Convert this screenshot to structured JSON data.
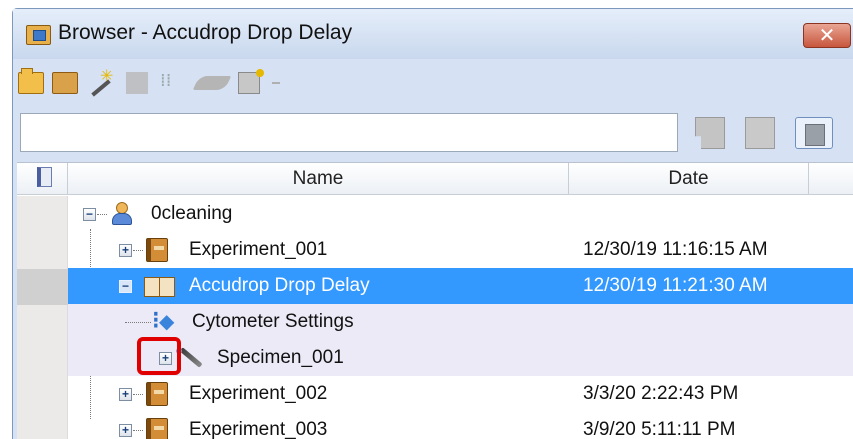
{
  "window": {
    "title": "Browser - Accudrop Drop Delay",
    "close_label": "✕"
  },
  "toolbar": {
    "icons": [
      "new-folder-icon",
      "new-experiment-icon",
      "new-specimen-icon",
      "new-tube-icon",
      "new-layout-icon",
      "eraser-icon",
      "properties-icon"
    ]
  },
  "search": {
    "value": "",
    "placeholder": ""
  },
  "grid": {
    "columns": [
      "Name",
      "Date"
    ],
    "rows": [
      {
        "label": "0cleaning",
        "date": "",
        "expander": "−",
        "icon": "person-icon"
      },
      {
        "label": "Experiment_001",
        "date": "12/30/19 11:16:15 AM",
        "expander": "+",
        "icon": "experiment-icon"
      },
      {
        "label": "Accudrop Drop Delay",
        "date": "12/30/19 11:21:30 AM",
        "expander": "−",
        "icon": "open-experiment-icon",
        "selected": true
      },
      {
        "label": "Cytometer Settings",
        "date": "",
        "expander": "",
        "icon": "cytometer-settings-icon"
      },
      {
        "label": "Specimen_001",
        "date": "",
        "expander": "+",
        "icon": "specimen-icon"
      },
      {
        "label": "Experiment_002",
        "date": "3/3/20 2:22:43 PM",
        "expander": "+",
        "icon": "experiment-icon"
      },
      {
        "label": "Experiment_003",
        "date": "3/9/20 5:11:11 PM",
        "expander": "+",
        "icon": "experiment-icon"
      }
    ]
  },
  "annotation": {
    "highlight_color": "#e00000",
    "target": "Specimen_001 expand button"
  },
  "colors": {
    "selection": "#3399ff",
    "alt_row": "#eceaf7",
    "close_button": "#c8563d"
  }
}
